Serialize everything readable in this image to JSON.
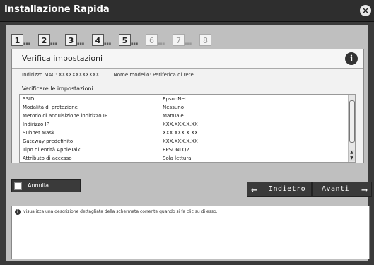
{
  "window": {
    "title": "Installazione Rapida",
    "close_icon": "×"
  },
  "steps": [
    {
      "num": "1",
      "state": "active"
    },
    {
      "num": "2",
      "state": "active"
    },
    {
      "num": "3",
      "state": "active"
    },
    {
      "num": "4",
      "state": "active"
    },
    {
      "num": "5",
      "state": "active"
    },
    {
      "num": "6",
      "state": "inactive"
    },
    {
      "num": "7",
      "state": "inactive"
    },
    {
      "num": "8",
      "state": "inactive"
    }
  ],
  "panel": {
    "heading": "Verifica impostazioni",
    "info_icon": "i",
    "mac_label": "Indirizzo MAC: XXXXXXXXXXXX",
    "model_label": "Nome modello: Periferica di rete",
    "verify_label": "Verificare le impostazioni."
  },
  "settings_rows": [
    {
      "key": "SSID",
      "value": "EpsonNet"
    },
    {
      "key": "Modalità di protezione",
      "value": "Nessuno"
    },
    {
      "key": "Metodo di acquisizione indirizzo IP",
      "value": "Manuale"
    },
    {
      "key": "Indirizzo IP",
      "value": "XXX.XXX.X.XX"
    },
    {
      "key": "Subnet Mask",
      "value": "XXX.XXX.X.XX"
    },
    {
      "key": "Gateway predefinito",
      "value": "XXX.XXX.X.XX"
    },
    {
      "key": "Tipo di entità AppleTalk",
      "value": "EPSONLQ2"
    },
    {
      "key": "Attributo di accesso",
      "value": "Sola lettura"
    }
  ],
  "buttons": {
    "cancel": "Annulla",
    "back": "Indietro",
    "next": "Avanti",
    "back_arrow": "←",
    "next_arrow": "→"
  },
  "help": {
    "icon": "i",
    "text": "visualizza una descrizione dettagliata della schermata corrente quando si fa clic su di esso."
  }
}
